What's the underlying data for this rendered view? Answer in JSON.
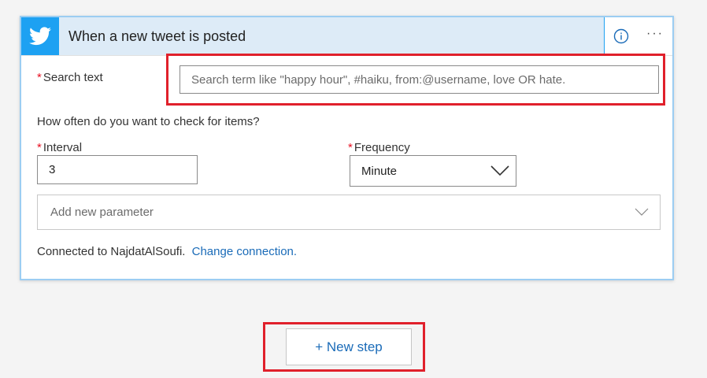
{
  "trigger": {
    "icon": "twitter-bird-icon",
    "title": "When a new tweet is posted",
    "info_icon": "info-icon",
    "more_label": "···"
  },
  "search": {
    "required_mark": "*",
    "label": "Search text",
    "placeholder": "Search term like \"happy hour\", #haiku, from:@username, love OR hate."
  },
  "question": "How often do you want to check for items?",
  "interval": {
    "required_mark": "*",
    "label": "Interval",
    "value": "3"
  },
  "frequency": {
    "required_mark": "*",
    "label": "Frequency",
    "value": "Minute",
    "icon": "chevron-down-icon"
  },
  "add_parameter": {
    "placeholder": "Add new parameter",
    "icon": "chevron-down-icon"
  },
  "connection": {
    "text": "Connected to NajdatAlSoufi.",
    "link": "Change connection."
  },
  "new_step": {
    "label": "+ New step"
  },
  "colors": {
    "accent": "#1da1f2",
    "link": "#1a6bb8",
    "highlight": "#e0202b",
    "required": "#e81123"
  }
}
